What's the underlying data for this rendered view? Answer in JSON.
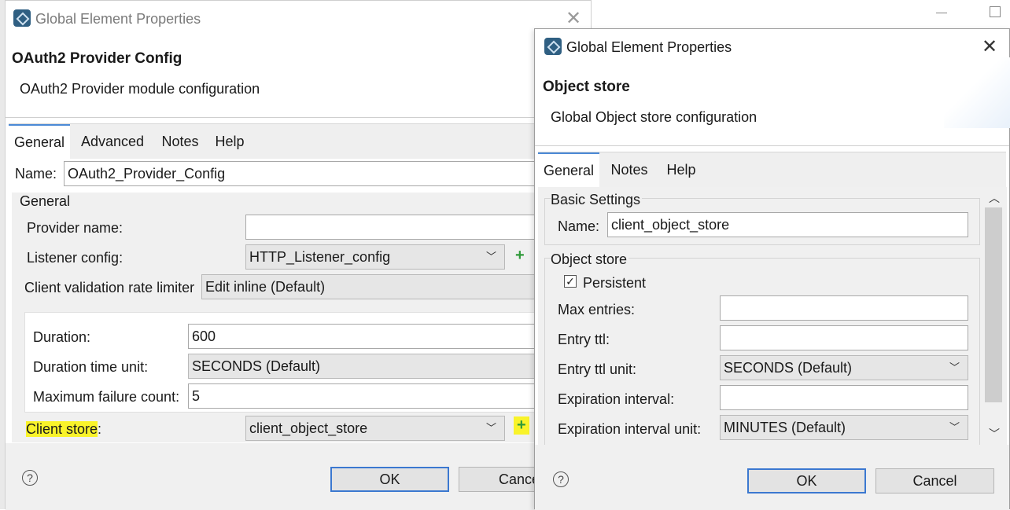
{
  "back_dialog": {
    "window_title": "Global Element Properties",
    "header_title": "OAuth2 Provider Config",
    "header_desc": "OAuth2 Provider module configuration",
    "tabs": [
      "General",
      "Advanced",
      "Notes",
      "Help"
    ],
    "name_label": "Name:",
    "name_value": "OAuth2_Provider_Config",
    "general_group": "General",
    "provider_name_label": "Provider name:",
    "provider_name_value": "",
    "listener_config_label": "Listener config:",
    "listener_config_value": "HTTP_Listener_config",
    "rate_limiter_label": "Client validation rate limiter",
    "rate_limiter_value": "Edit inline (Default)",
    "duration_label": "Duration:",
    "duration_value": "600",
    "duration_unit_label": "Duration time unit:",
    "duration_unit_value": "SECONDS (Default)",
    "max_fail_label": "Maximum failure count:",
    "max_fail_value": "5",
    "client_store_label_highlight": "Client store",
    "client_store_label_rest": ":",
    "client_store_value": "client_object_store",
    "ok_label": "OK",
    "cancel_label": "Cance"
  },
  "front_dialog": {
    "window_title": "Global Element Properties",
    "header_title": "Object store",
    "header_desc": "Global Object store configuration",
    "tabs": [
      "General",
      "Notes",
      "Help"
    ],
    "basic_group": "Basic Settings",
    "name_label": "Name:",
    "name_value": "client_object_store",
    "object_store_group": "Object store",
    "persistent_label": "Persistent",
    "persistent_checked": true,
    "max_entries_label": "Max entries:",
    "max_entries_value": "",
    "entry_ttl_label": "Entry ttl:",
    "entry_ttl_value": "",
    "entry_ttl_unit_label": "Entry ttl unit:",
    "entry_ttl_unit_value": "SECONDS (Default)",
    "expiration_interval_label": "Expiration interval:",
    "expiration_interval_value": "",
    "expiration_unit_label": "Expiration interval unit:",
    "expiration_unit_value": "MINUTES (Default)",
    "ok_label": "OK",
    "cancel_label": "Cancel"
  },
  "icons": {
    "close": "close-icon",
    "dropdown": "chevron-down-icon",
    "add": "plus-icon",
    "help": "help-icon",
    "check": "checkmark-icon"
  },
  "colors": {
    "accent": "#3b78d0",
    "highlight": "#f9f32a",
    "add_green": "#2f9a3a"
  }
}
